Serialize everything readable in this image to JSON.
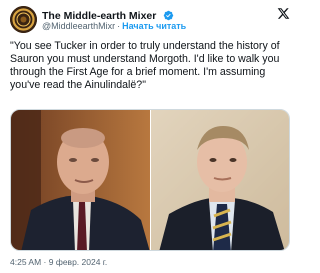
{
  "author": {
    "name": "The Middle-earth Mixer",
    "handle": "@MiddleearthMixr",
    "follow_label": "Начать читать",
    "separator": "·"
  },
  "tweet": {
    "text": "\"You see Tucker in order to truly understand the history of Sauron you must understand Morgoth. I'd like to walk you through the First Age for a brief moment. I'm assuming you've read the Ainulindalë?\""
  },
  "footer": {
    "timestamp": "4:25 AM · 9 февр. 2024 г."
  },
  "colors": {
    "accent": "#1d9bf0",
    "text": "#0f1419",
    "muted": "#536471"
  },
  "icons": {
    "verified": "verified-badge-icon",
    "platform": "x-logo-icon"
  }
}
